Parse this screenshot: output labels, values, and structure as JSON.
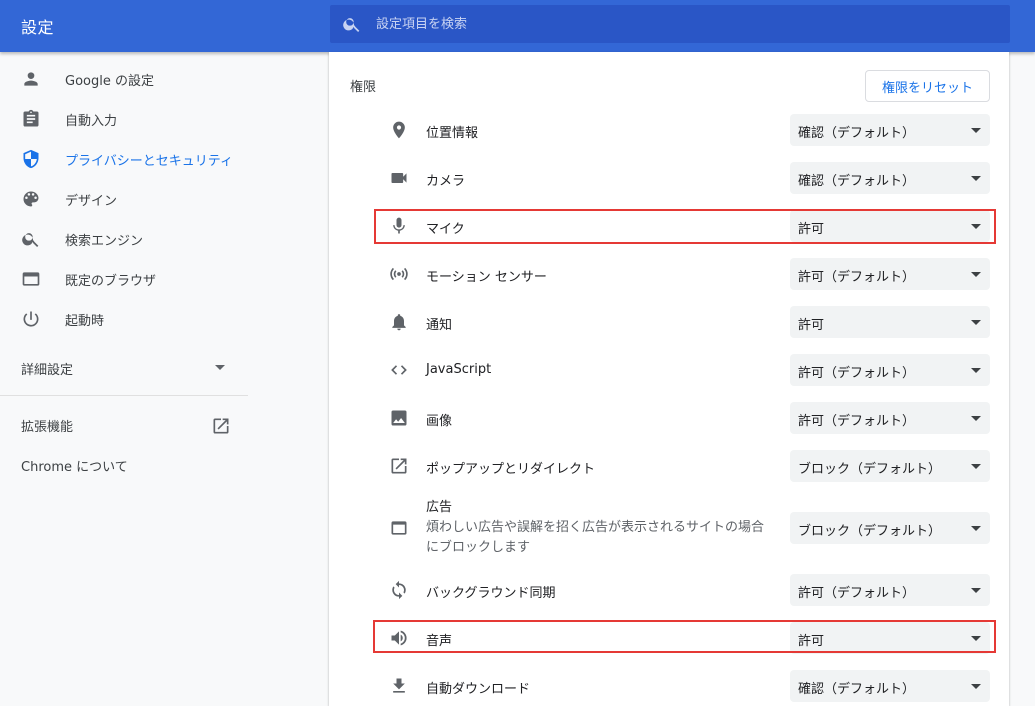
{
  "header": {
    "title": "設定",
    "search_placeholder": "設定項目を検索"
  },
  "sidebar": {
    "items": [
      {
        "label": "Google の設定",
        "icon": "person-icon"
      },
      {
        "label": "自動入力",
        "icon": "clipboard-icon"
      },
      {
        "label": "プライバシーとセキュリティ",
        "icon": "shield-icon",
        "active": true
      },
      {
        "label": "デザイン",
        "icon": "palette-icon"
      },
      {
        "label": "検索エンジン",
        "icon": "search-icon"
      },
      {
        "label": "既定のブラウザ",
        "icon": "browser-icon"
      },
      {
        "label": "起動時",
        "icon": "power-icon"
      }
    ],
    "advanced_label": "詳細設定",
    "extensions_label": "拡張機能",
    "about_label": "Chrome について"
  },
  "main": {
    "section_title": "権限",
    "reset_label": "権限をリセット",
    "permissions": [
      {
        "label": "位置情報",
        "value": "確認（デフォルト）",
        "icon": "location-pin-icon"
      },
      {
        "label": "カメラ",
        "value": "確認（デフォルト）",
        "icon": "camera-icon"
      },
      {
        "label": "マイク",
        "value": "許可",
        "icon": "microphone-icon",
        "highlighted": true
      },
      {
        "label": "モーション センサー",
        "value": "許可（デフォルト）",
        "icon": "motion-sensor-icon"
      },
      {
        "label": "通知",
        "value": "許可",
        "icon": "bell-icon"
      },
      {
        "label": "JavaScript",
        "value": "許可（デフォルト）",
        "icon": "code-icon"
      },
      {
        "label": "画像",
        "value": "許可（デフォルト）",
        "icon": "image-icon"
      },
      {
        "label": "ポップアップとリダイレクト",
        "value": "ブロック（デフォルト）",
        "icon": "open-in-new-icon"
      },
      {
        "label": "広告",
        "description": "煩わしい広告や誤解を招く広告が表示されるサイトの場合にブロックします",
        "value": "ブロック（デフォルト）",
        "icon": "ads-window-icon"
      },
      {
        "label": "バックグラウンド同期",
        "value": "許可（デフォルト）",
        "icon": "sync-icon"
      },
      {
        "label": "音声",
        "value": "許可",
        "icon": "speaker-icon",
        "highlighted": true
      },
      {
        "label": "自動ダウンロード",
        "value": "確認（デフォルト）",
        "icon": "download-icon"
      }
    ]
  },
  "colors": {
    "header": "#3367d6",
    "accent": "#1a73e8",
    "highlight": "#e53935"
  }
}
